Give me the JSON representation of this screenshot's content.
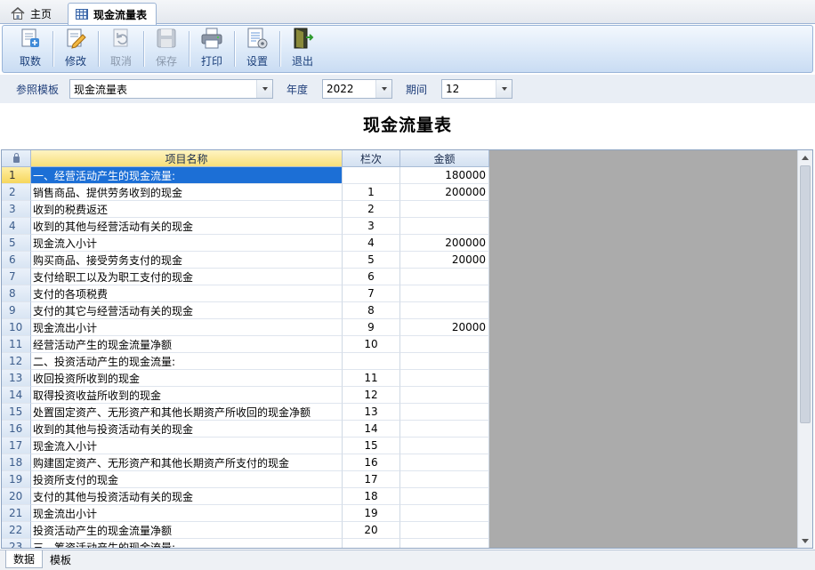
{
  "tabs": {
    "home": "主页",
    "active": "现金流量表"
  },
  "toolbar": {
    "fetch": "取数",
    "edit": "修改",
    "cancel": "取消",
    "save": "保存",
    "print": "打印",
    "settings": "设置",
    "exit": "退出"
  },
  "params": {
    "template_label": "参照模板",
    "template_value": "现金流量表",
    "year_label": "年度",
    "year_value": "2022",
    "period_label": "期间",
    "period_value": "12"
  },
  "report_title": "现金流量表",
  "grid": {
    "headers": {
      "name": "项目名称",
      "line": "栏次",
      "amount": "金额"
    },
    "rows": [
      {
        "no": "1",
        "name": "一、经营活动产生的现金流量:",
        "line": "",
        "amount": "180000"
      },
      {
        "no": "2",
        "name": "销售商品、提供劳务收到的现金",
        "line": "1",
        "amount": "200000"
      },
      {
        "no": "3",
        "name": "收到的税费返还",
        "line": "2",
        "amount": ""
      },
      {
        "no": "4",
        "name": "收到的其他与经营活动有关的现金",
        "line": "3",
        "amount": ""
      },
      {
        "no": "5",
        "name": "现金流入小计",
        "line": "4",
        "amount": "200000"
      },
      {
        "no": "6",
        "name": "购买商品、接受劳务支付的现金",
        "line": "5",
        "amount": "20000"
      },
      {
        "no": "7",
        "name": "支付给职工以及为职工支付的现金",
        "line": "6",
        "amount": ""
      },
      {
        "no": "8",
        "name": "支付的各项税费",
        "line": "7",
        "amount": ""
      },
      {
        "no": "9",
        "name": "支付的其它与经营活动有关的现金",
        "line": "8",
        "amount": ""
      },
      {
        "no": "10",
        "name": "现金流出小计",
        "line": "9",
        "amount": "20000"
      },
      {
        "no": "11",
        "name": "经营活动产生的现金流量净额",
        "line": "10",
        "amount": ""
      },
      {
        "no": "12",
        "name": "二、投资活动产生的现金流量:",
        "line": "",
        "amount": ""
      },
      {
        "no": "13",
        "name": "收回投资所收到的现金",
        "line": "11",
        "amount": ""
      },
      {
        "no": "14",
        "name": "取得投资收益所收到的现金",
        "line": "12",
        "amount": ""
      },
      {
        "no": "15",
        "name": "处置固定资产、无形资产和其他长期资产所收回的现金净额",
        "line": "13",
        "amount": ""
      },
      {
        "no": "16",
        "name": "收到的其他与投资活动有关的现金",
        "line": "14",
        "amount": ""
      },
      {
        "no": "17",
        "name": "现金流入小计",
        "line": "15",
        "amount": ""
      },
      {
        "no": "18",
        "name": "购建固定资产、无形资产和其他长期资产所支付的现金",
        "line": "16",
        "amount": ""
      },
      {
        "no": "19",
        "name": "投资所支付的现金",
        "line": "17",
        "amount": ""
      },
      {
        "no": "20",
        "name": "支付的其他与投资活动有关的现金",
        "line": "18",
        "amount": ""
      },
      {
        "no": "21",
        "name": "现金流出小计",
        "line": "19",
        "amount": ""
      },
      {
        "no": "22",
        "name": "投资活动产生的现金流量净额",
        "line": "20",
        "amount": ""
      },
      {
        "no": "23",
        "name": "三、筹资活动产生的现金流量:",
        "line": "",
        "amount": ""
      }
    ]
  },
  "sheet_tabs": {
    "data": "数据",
    "template": "模板"
  },
  "colors": {
    "accent": "#1c6fd6",
    "toolbar_text": "#1b3f7a",
    "grid_bg": "#ababab"
  }
}
